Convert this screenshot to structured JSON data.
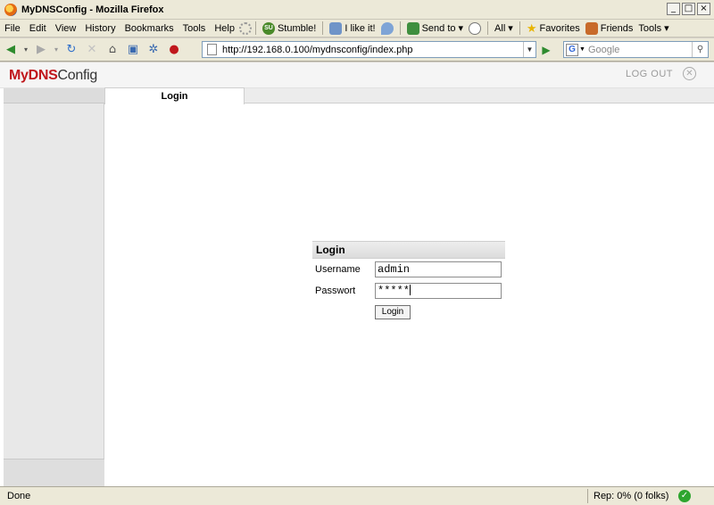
{
  "window": {
    "title": "MyDNSConfig - Mozilla Firefox",
    "controls": [
      "_",
      "□",
      "×"
    ]
  },
  "menubar": {
    "items": [
      "File",
      "Edit",
      "View",
      "History",
      "Bookmarks",
      "Tools",
      "Help"
    ],
    "toolbar": {
      "stumble": "Stumble!",
      "like": "I like it!",
      "send_to": "Send to",
      "all": "All",
      "favorites": "Favorites",
      "friends": "Friends",
      "tools": "Tools"
    }
  },
  "navbar": {
    "url": "http://192.168.0.100/mydnsconfig/index.php",
    "search_placeholder": "Google",
    "search_engine": "G"
  },
  "app": {
    "logo_my": "My",
    "logo_dns": "DNS",
    "logo_config": "Config",
    "logout": "LOG OUT",
    "tab_label": "Login"
  },
  "login": {
    "header": "Login",
    "username_label": "Username",
    "username_value": "admin",
    "password_label": "Passwort",
    "password_value": "*****",
    "button": "Login"
  },
  "status": {
    "text": "Done",
    "rep": "Rep: 0% (0 folks)"
  },
  "colors": {
    "logo_accent": "#c0171c",
    "chrome": "#ece9d8"
  }
}
